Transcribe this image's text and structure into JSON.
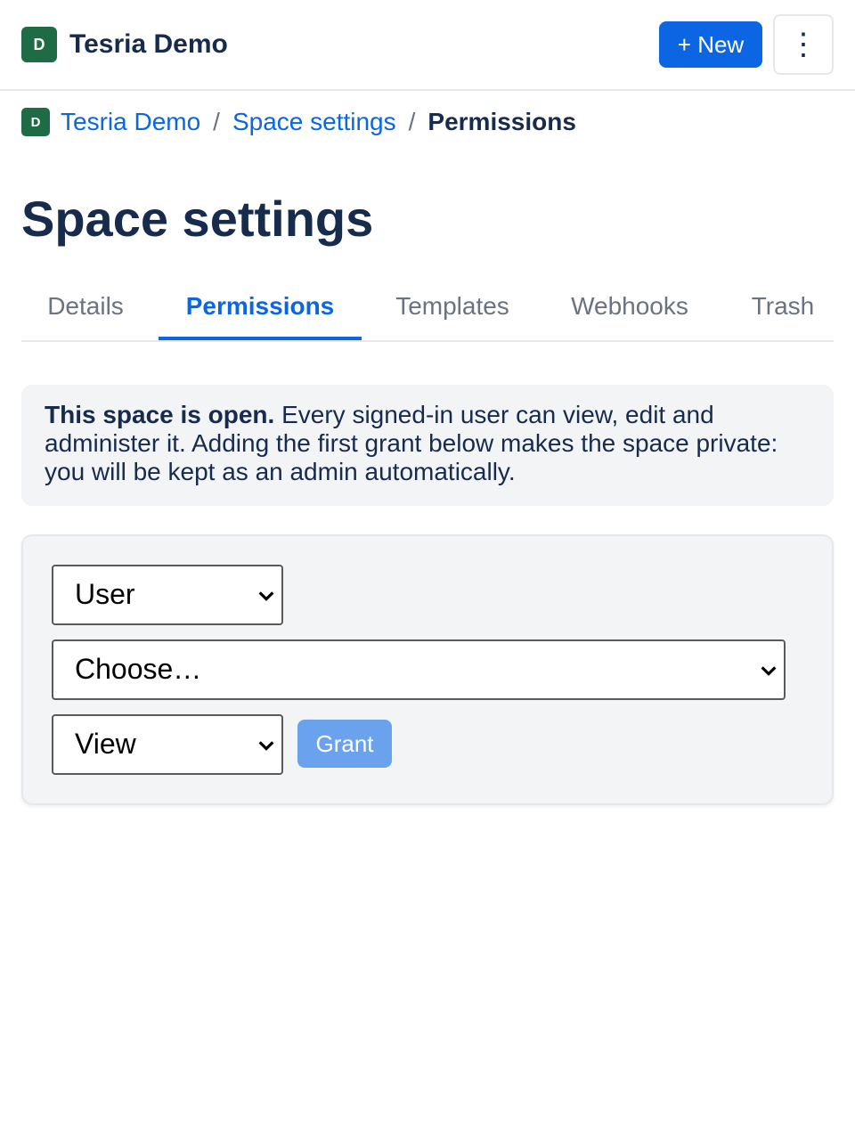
{
  "header": {
    "space_avatar": "D",
    "app_title": "Tesria Demo",
    "new_button_label": "+ New",
    "more_button_label": "⋮"
  },
  "breadcrumb": {
    "avatar": "D",
    "items": [
      "Tesria Demo",
      "Space settings"
    ],
    "separator": "/",
    "current": "Permissions"
  },
  "page": {
    "title": "Space settings"
  },
  "tabs": [
    {
      "label": "Details",
      "active": false
    },
    {
      "label": "Permissions",
      "active": true
    },
    {
      "label": "Templates",
      "active": false
    },
    {
      "label": "Webhooks",
      "active": false
    },
    {
      "label": "Trash",
      "active": false
    }
  ],
  "notice": {
    "bold": "This space is open.",
    "text": " Every signed-in user can view, edit and administer it. Adding the first grant below makes the space private: you will be kept as an admin automatically."
  },
  "grant_form": {
    "principal_type": "User",
    "principal": "Choose…",
    "role": "View",
    "grant_button_label": "Grant"
  },
  "colors": {
    "accent": "#0c66e4",
    "space_avatar": "#1f6b45",
    "grant_disabled": "#6aa2ee"
  }
}
